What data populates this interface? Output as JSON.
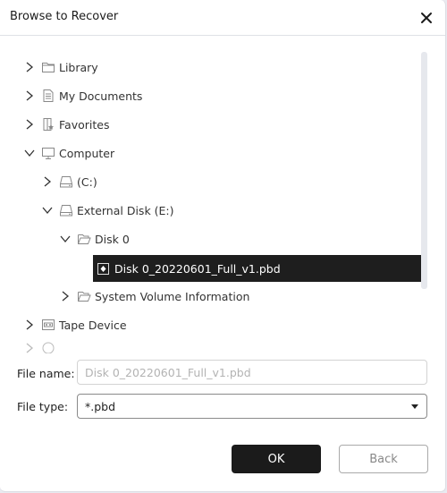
{
  "dialog": {
    "title": "Browse to Recover",
    "close_icon": "close-icon"
  },
  "tree": {
    "items": [
      {
        "label": "Library",
        "icon": "folder-icon",
        "expanded": false,
        "level": 0
      },
      {
        "label": "My Documents",
        "icon": "document-icon",
        "expanded": false,
        "level": 0
      },
      {
        "label": "Favorites",
        "icon": "favorites-icon",
        "expanded": false,
        "level": 0
      },
      {
        "label": "Computer",
        "icon": "computer-icon",
        "expanded": true,
        "level": 0
      },
      {
        "label": "(C:)",
        "icon": "drive-icon",
        "expanded": false,
        "level": 1
      },
      {
        "label": "External Disk (E:)",
        "icon": "drive-icon",
        "expanded": true,
        "level": 1
      },
      {
        "label": "Disk 0",
        "icon": "folder-open-icon",
        "expanded": true,
        "level": 2
      },
      {
        "label": "Disk 0_20220601_Full_v1.pbd",
        "icon": "backup-file-icon",
        "selected": true,
        "level": 3
      },
      {
        "label": "System Volume Information",
        "icon": "folder-open-icon",
        "expanded": false,
        "level": 2
      },
      {
        "label": "Tape Device",
        "icon": "tape-icon",
        "expanded": false,
        "level": 0
      },
      {
        "label": "",
        "icon": "network-icon",
        "expanded": false,
        "level": 0
      }
    ]
  },
  "form": {
    "file_name_label": "File name:",
    "file_name_placeholder": "Disk 0_20220601_Full_v1.pbd",
    "file_type_label": "File type:",
    "file_type_value": "*.pbd"
  },
  "buttons": {
    "ok": "OK",
    "back": "Back"
  }
}
